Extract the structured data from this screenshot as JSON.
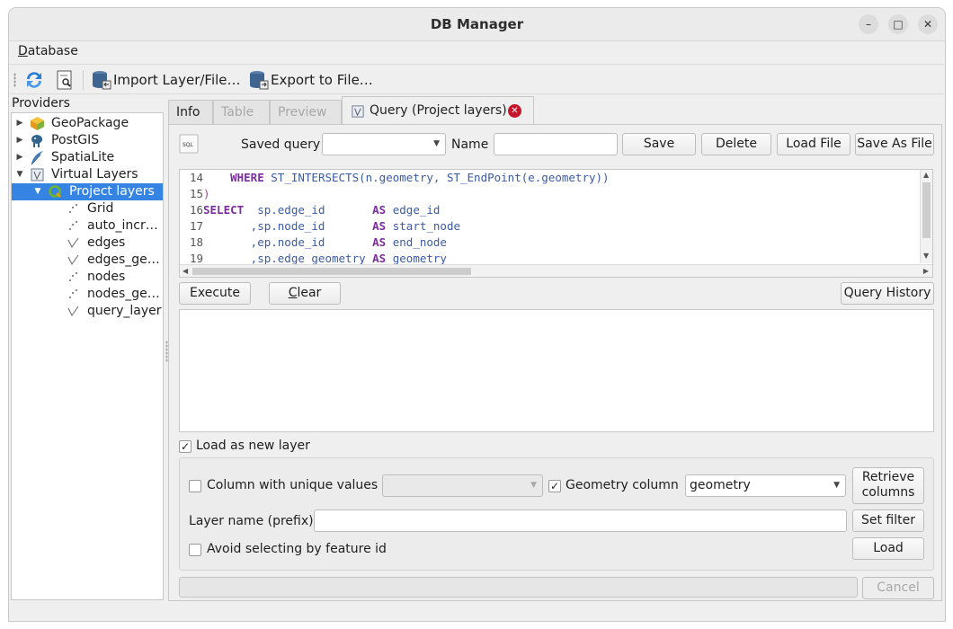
{
  "window": {
    "title": "DB Manager",
    "controls": {
      "minimize": "–",
      "maximize": "□",
      "close": "✕"
    }
  },
  "menubar": {
    "database_prefix": "D",
    "database_rest": "atabase"
  },
  "toolbar": {
    "import_label": "Import Layer/File…",
    "export_label": "Export to File…"
  },
  "sidebar": {
    "header": "Providers",
    "items": [
      {
        "label": "GeoPackage",
        "icon": "geopackage-icon",
        "expander": "▶"
      },
      {
        "label": "PostGIS",
        "icon": "postgis-elephant-icon",
        "expander": "▶"
      },
      {
        "label": "SpatiaLite",
        "icon": "spatialite-feather-icon",
        "expander": "▶"
      },
      {
        "label": "Virtual Layers",
        "icon": "virtual-layers-icon",
        "expander": "▼"
      },
      {
        "label": "Project layers",
        "icon": "qgis-project-icon",
        "expander": "▼"
      },
      {
        "label": "Grid",
        "icon": "point-layer-icon"
      },
      {
        "label": "auto_incr…",
        "icon": "point-layer-icon"
      },
      {
        "label": "edges",
        "icon": "line-layer-icon"
      },
      {
        "label": "edges_ge…",
        "icon": "line-layer-icon"
      },
      {
        "label": "nodes",
        "icon": "point-layer-icon"
      },
      {
        "label": "nodes_ge…",
        "icon": "point-layer-icon"
      },
      {
        "label": "query_layer",
        "icon": "line-layer-icon"
      }
    ]
  },
  "tabs": [
    {
      "label": "Info"
    },
    {
      "label": "Table"
    },
    {
      "label": "Preview"
    },
    {
      "label": "Query (Project layers)"
    }
  ],
  "query": {
    "saved_query_label": "Saved query",
    "saved_query_value": "",
    "name_label": "Name",
    "name_value": "",
    "save": "Save",
    "delete": "Delete",
    "load_file": "Load File",
    "save_as_file": "Save As File",
    "code_lines": [
      {
        "n": "14",
        "text": "    WHERE ST_INTERSECTS(n.geometry, ST_EndPoint(e.geometry))"
      },
      {
        "n": "15",
        "text": ")"
      },
      {
        "n": "16",
        "text": "SELECT  sp.edge_id       AS edge_id"
      },
      {
        "n": "17",
        "text": "       ,sp.node_id       AS start_node"
      },
      {
        "n": "18",
        "text": "       ,ep.node_id       AS end_node"
      },
      {
        "n": "19",
        "text": "       ,sp.edge_geometry AS geometry"
      }
    ],
    "execute": "Execute",
    "clear_prefix": "C",
    "clear_rest": "lear",
    "query_history": "Query History",
    "load_as_new_layer": "Load as new layer",
    "column_unique": "Column with unique values",
    "geometry_column_label": "Geometry column",
    "geometry_column_value": "geometry",
    "retrieve_columns_1": "Retrieve",
    "retrieve_columns_2": "columns",
    "layer_name_label": "Layer name (prefix)",
    "layer_name_value": "",
    "set_filter": "Set filter",
    "avoid_selecting": "Avoid selecting by feature id",
    "load": "Load",
    "cancel": "Cancel"
  },
  "state": {
    "load_as_new_layer_checked": true,
    "geometry_column_checked": true,
    "column_unique_checked": false,
    "avoid_selecting_checked": false
  },
  "colors": {
    "selection": "#3584e4",
    "keyword": "#7a2d9c",
    "identifier": "#3b5ba5",
    "close_badge": "#c7162b"
  }
}
